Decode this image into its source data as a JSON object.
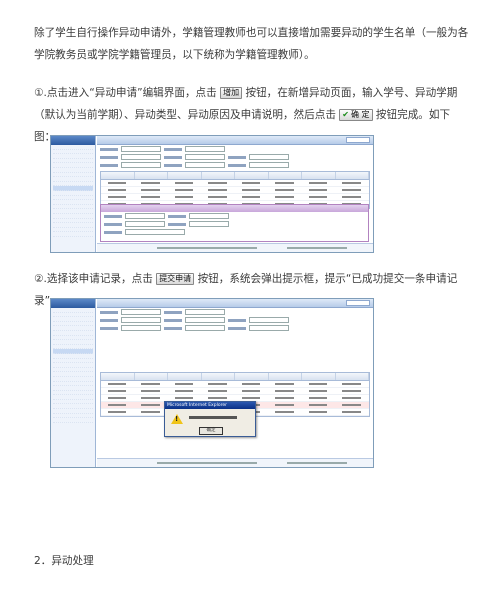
{
  "paragraphs": {
    "intro": "除了学生自行操作异动申请外，学籍管理教师也可以直接增加需要异动的学生名单（一般为各学院教务员或学院学籍管理员，以下统称为学籍管理教师）。",
    "step1_a": "①.点击进入“异动申请”编辑界面，点击",
    "step1_b": "按钮，在新增异动页面，输入学号、异动学期（默认为当前学期）、异动类型、异动原因及申请说明，然后点击",
    "step1_c": "按钮完成。如下图：",
    "step2_a": "②.选择该申请记录，点击",
    "step2_b": "按钮，系统会弹出提示框，提示“已成功提交一条申请记录”。",
    "section2": "2．异动处理"
  },
  "inline_buttons": {
    "add": "增加",
    "confirm": "确 定",
    "submit": "提交申请"
  },
  "screenshot2": {
    "dialog_title": "Microsoft Internet Explorer",
    "dialog_ok": "确定"
  },
  "icons": {
    "confirm_check": "check-icon",
    "dialog_warning": "warning-icon"
  }
}
